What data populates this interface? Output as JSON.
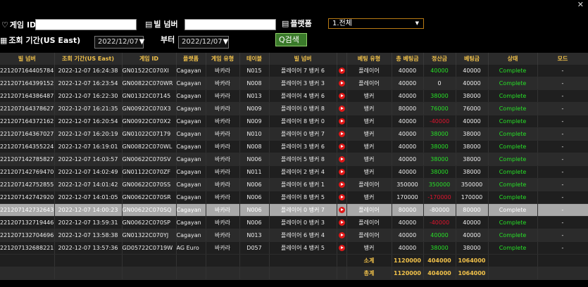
{
  "filters": {
    "game_id_label": "게임 ID",
    "bill_no_label": "빌 넘버",
    "platform_label": "플랫폼",
    "platform_value": "1.전체",
    "period_label": "조회 기간(US East)",
    "from_date": "2022/12/07",
    "to_label": "부터",
    "to_date": "2022/12/07",
    "search_label": "검색"
  },
  "columns": [
    "빌 넘버",
    "조회 기간(US East)",
    "게임 ID",
    "플랫폼",
    "게임 유형",
    "테이블",
    "빌 넘버",
    "",
    "베팅 유형",
    "총 베팅금",
    "정산금",
    "베팅금",
    "상태",
    "모드"
  ],
  "rows": [
    {
      "bill": "221207164405784",
      "time": "2022-12-07 16:24:38",
      "game_id": "GN01522C070XI",
      "platform": "Cagayan",
      "game_type": "바카라",
      "table": "N015",
      "bill_detail": "플레이어 7 뱅커 6",
      "bet_type": "플레이어",
      "total_bet": "40000",
      "payout": "40000",
      "bet": "40000",
      "status": "Complete",
      "mode": "-",
      "payout_color": "green"
    },
    {
      "bill": "221207164399152",
      "time": "2022-12-07 16:23:54",
      "game_id": "GN00822C070WR",
      "platform": "Cagayan",
      "game_type": "바카라",
      "table": "N008",
      "bill_detail": "플레이어 3 뱅커 3",
      "bet_type": "플레이어",
      "total_bet": "40000",
      "payout": "0",
      "bet": "40000",
      "status": "Complete",
      "mode": "-",
      "payout_color": "white"
    },
    {
      "bill": "221207164386487",
      "time": "2022-12-07 16:22:30",
      "game_id": "GN01322C07145",
      "platform": "Cagayan",
      "game_type": "바카라",
      "table": "N013",
      "bill_detail": "플레이어 4 뱅커 6",
      "bet_type": "뱅커",
      "total_bet": "40000",
      "payout": "38000",
      "bet": "38000",
      "status": "Complete",
      "mode": "-",
      "payout_color": "green"
    },
    {
      "bill": "221207164378627",
      "time": "2022-12-07 16:21:35",
      "game_id": "GN00922C070X3",
      "platform": "Cagayan",
      "game_type": "바카라",
      "table": "N009",
      "bill_detail": "플레이어 0 뱅커 8",
      "bet_type": "뱅커",
      "total_bet": "80000",
      "payout": "76000",
      "bet": "76000",
      "status": "Complete",
      "mode": "-",
      "payout_color": "green"
    },
    {
      "bill": "221207164372162",
      "time": "2022-12-07 16:20:54",
      "game_id": "GN00922C070X2",
      "platform": "Cagayan",
      "game_type": "바카라",
      "table": "N009",
      "bill_detail": "플레이어 8 뱅커 0",
      "bet_type": "뱅커",
      "total_bet": "40000",
      "payout": "-40000",
      "bet": "40000",
      "status": "Complete",
      "mode": "-",
      "payout_color": "red"
    },
    {
      "bill": "221207164367027",
      "time": "2022-12-07 16:20:19",
      "game_id": "GN01022C07179",
      "platform": "Cagayan",
      "game_type": "바카라",
      "table": "N010",
      "bill_detail": "플레이어 0 뱅커 7",
      "bet_type": "뱅커",
      "total_bet": "40000",
      "payout": "38000",
      "bet": "38000",
      "status": "Complete",
      "mode": "-",
      "payout_color": "green"
    },
    {
      "bill": "221207164355224",
      "time": "2022-12-07 16:19:01",
      "game_id": "GN00822C070WL",
      "platform": "Cagayan",
      "game_type": "바카라",
      "table": "N008",
      "bill_detail": "플레이어 3 뱅커 6",
      "bet_type": "뱅커",
      "total_bet": "40000",
      "payout": "38000",
      "bet": "38000",
      "status": "Complete",
      "mode": "-",
      "payout_color": "green"
    },
    {
      "bill": "221207142785827",
      "time": "2022-12-07 14:03:57",
      "game_id": "GN00622C070SV",
      "platform": "Cagayan",
      "game_type": "바카라",
      "table": "N006",
      "bill_detail": "플레이어 5 뱅커 8",
      "bet_type": "뱅커",
      "total_bet": "40000",
      "payout": "38000",
      "bet": "38000",
      "status": "Complete",
      "mode": "-",
      "payout_color": "green"
    },
    {
      "bill": "221207142769470",
      "time": "2022-12-07 14:02:49",
      "game_id": "GN01122C070ZF",
      "platform": "Cagayan",
      "game_type": "바카라",
      "table": "N011",
      "bill_detail": "플레이어 2 뱅커 4",
      "bet_type": "뱅커",
      "total_bet": "40000",
      "payout": "38000",
      "bet": "38000",
      "status": "Complete",
      "mode": "-",
      "payout_color": "green"
    },
    {
      "bill": "221207142752855",
      "time": "2022-12-07 14:01:42",
      "game_id": "GN00622C070SS",
      "platform": "Cagayan",
      "game_type": "바카라",
      "table": "N006",
      "bill_detail": "플레이어 6 뱅커 1",
      "bet_type": "플레이어",
      "total_bet": "350000",
      "payout": "350000",
      "bet": "350000",
      "status": "Complete",
      "mode": "-",
      "payout_color": "green"
    },
    {
      "bill": "221207142742920",
      "time": "2022-12-07 14:01:05",
      "game_id": "GN00622C070SR",
      "platform": "Cagayan",
      "game_type": "바카라",
      "table": "N006",
      "bill_detail": "플레이어 8 뱅커 5",
      "bet_type": "뱅커",
      "total_bet": "170000",
      "payout": "-170000",
      "bet": "170000",
      "status": "Complete",
      "mode": "-",
      "payout_color": "red"
    },
    {
      "bill": "221207142732643",
      "time": "2022-12-07 14:00:23",
      "game_id": "GN00622C070SQ",
      "platform": "Cagayan",
      "game_type": "바카라",
      "table": "N006",
      "bill_detail": "플레이어 0 뱅커 7",
      "bet_type": "플레이어",
      "total_bet": "80000",
      "payout": "-80000",
      "bet": "80000",
      "status": "Complete",
      "mode": "-",
      "payout_color": "red",
      "selected": true
    },
    {
      "bill": "221207132719446",
      "time": "2022-12-07 13:59:31",
      "game_id": "GN00622C070SP",
      "platform": "Cagayan",
      "game_type": "바카라",
      "table": "N006",
      "bill_detail": "플레이어 0 뱅커 3",
      "bet_type": "플레이어",
      "total_bet": "40000",
      "payout": "-40000",
      "bet": "40000",
      "status": "Complete",
      "mode": "-",
      "payout_color": "red"
    },
    {
      "bill": "221207132704696",
      "time": "2022-12-07 13:58:38",
      "game_id": "GN01322C070YJ",
      "platform": "Cagayan",
      "game_type": "바카라",
      "table": "N013",
      "bill_detail": "플레이어 6 뱅커 4",
      "bet_type": "플레이어",
      "total_bet": "40000",
      "payout": "40000",
      "bet": "40000",
      "status": "Complete",
      "mode": "-",
      "payout_color": "green"
    },
    {
      "bill": "221207132688221",
      "time": "2022-12-07 13:57:36",
      "game_id": "GD05722C0719W",
      "platform": "AG Euro",
      "game_type": "바카라",
      "table": "D057",
      "bill_detail": "플레이어 4 뱅커 5",
      "bet_type": "뱅커",
      "total_bet": "40000",
      "payout": "38000",
      "bet": "38000",
      "status": "Complete",
      "mode": "-",
      "payout_color": "green"
    }
  ],
  "subtotal": {
    "label": "소계",
    "total_bet": "1120000",
    "payout": "404000",
    "bet": "1064000"
  },
  "total": {
    "label": "총계",
    "total_bet": "1120000",
    "payout": "404000",
    "bet": "1064000"
  },
  "colors": {
    "header_text": "#f2c24a",
    "positive": "#27e027",
    "negative": "#e0142e",
    "play_icon": "#e01818"
  },
  "icons": {
    "close": "close-icon",
    "game_id": "shield-icon",
    "bill": "document-icon",
    "platform": "list-icon",
    "calendar": "calendar-icon",
    "search": "search-icon",
    "play": "play-icon"
  }
}
